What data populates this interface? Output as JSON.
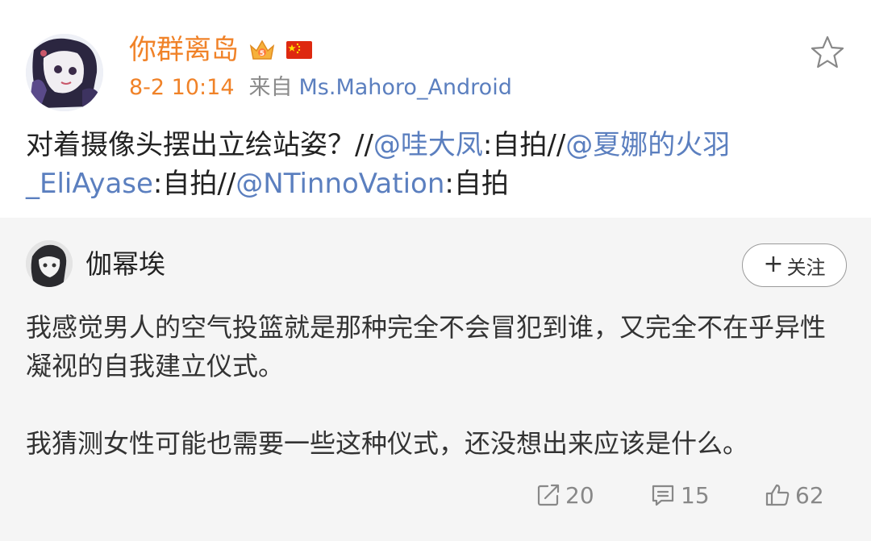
{
  "post": {
    "author": "你群离岛",
    "time": "8-2 10:14",
    "source_prefix": "来自",
    "source_client": "Ms.Mahoro_Android",
    "text_segments": [
      {
        "text": "对着摄像头摆出立绘站姿？//",
        "mention": false
      },
      {
        "text": "@哇大凤",
        "mention": true
      },
      {
        "text": ":自拍//",
        "mention": false
      },
      {
        "text": "@夏娜的火羽_EliAyase",
        "mention": true
      },
      {
        "text": ":自拍//",
        "mention": false
      },
      {
        "text": "@NTinnoVation",
        "mention": true
      },
      {
        "text": ":自拍",
        "mention": false
      }
    ],
    "icons": {
      "vip_badge": "crown-badge-icon",
      "flag": "china-flag-icon",
      "favorite": "star-icon"
    }
  },
  "repost": {
    "author": "伽幂埃",
    "follow_label": "关注",
    "paragraphs": [
      "我感觉男人的空气投篮就是那种完全不会冒犯到谁，又完全不在乎异性凝视的自我建立仪式。",
      "我猜测女性可能也需要一些这种仪式，还没想出来应该是什么。"
    ],
    "stats": {
      "reposts": "20",
      "comments": "15",
      "likes": "62"
    }
  },
  "colors": {
    "accent_orange": "#f08228",
    "link_blue": "#5b7fbf",
    "repost_bg": "#f5f5f5",
    "muted": "#888888"
  }
}
